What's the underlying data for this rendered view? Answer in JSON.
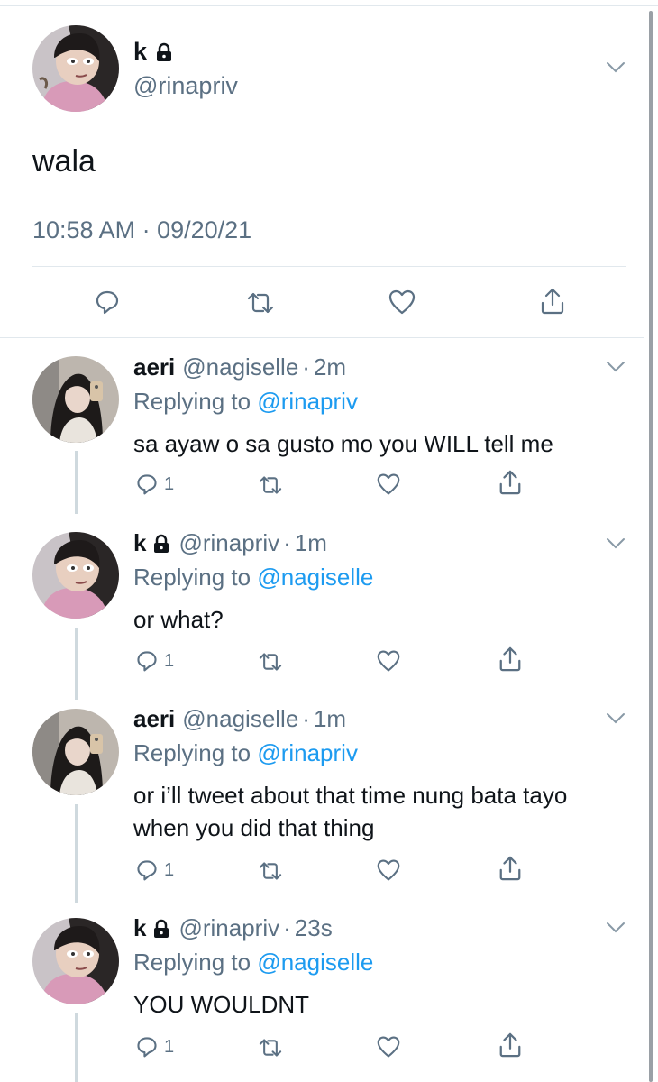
{
  "main_tweet": {
    "name": "k",
    "handle": "@rinapriv",
    "text": "wala",
    "timestamp": "10:58 AM · 09/20/21"
  },
  "replies": [
    {
      "name": "aeri",
      "handle": "@nagiselle",
      "time": "2m",
      "replying_label": "Replying to",
      "replying_to": "@rinapriv",
      "text_lines": [
        "sa ayaw o sa gusto mo you WILL tell me"
      ],
      "reply_count": "1"
    },
    {
      "name": "k",
      "handle": "@rinapriv",
      "time": "1m",
      "replying_label": "Replying to",
      "replying_to": "@nagiselle",
      "text_lines": [
        "or what?"
      ],
      "reply_count": "1"
    },
    {
      "name": "aeri",
      "handle": "@nagiselle",
      "time": "1m",
      "replying_label": "Replying to",
      "replying_to": "@rinapriv",
      "text_lines": [
        "or i’ll tweet about that time nung bata tayo",
        "when you did that thing"
      ],
      "reply_count": "1"
    },
    {
      "name": "k",
      "handle": "@rinapriv",
      "time": "23s",
      "replying_label": "Replying to",
      "replying_to": "@nagiselle",
      "text_lines": [
        "YOU WOULDNT"
      ],
      "reply_count": "1"
    }
  ],
  "colors": {
    "text": "#0f1419",
    "secondary": "#5b7083",
    "link": "#1d9bf0",
    "divider": "#e1e8ed"
  }
}
